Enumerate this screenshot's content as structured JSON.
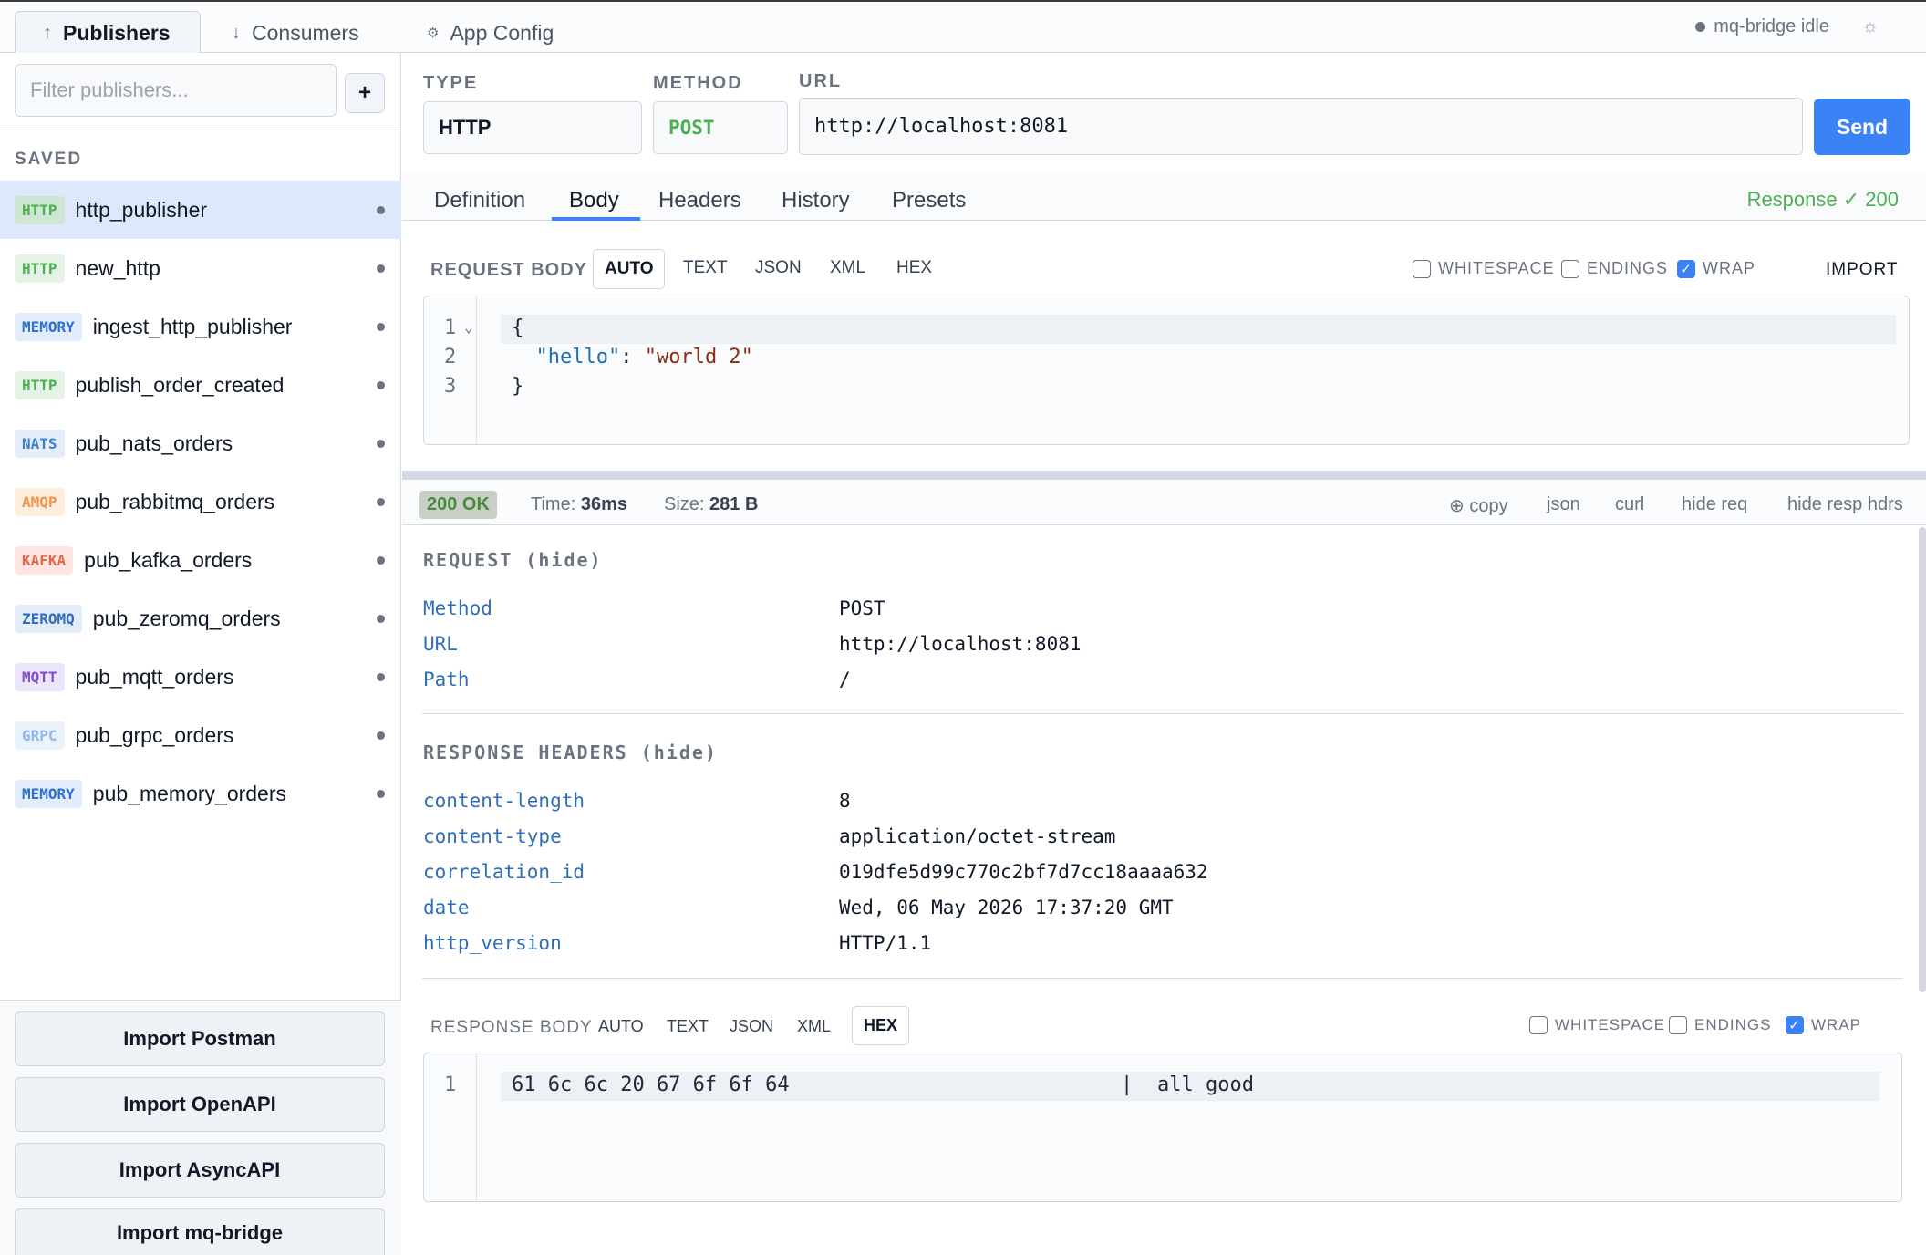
{
  "tabs": [
    {
      "label": "Publishers",
      "icon": "↑"
    },
    {
      "label": "Consumers",
      "icon": "↓"
    },
    {
      "label": "App Config",
      "icon": "⚙"
    }
  ],
  "status_text": "mq-bridge idle",
  "sidebar": {
    "filter_placeholder": "Filter publishers...",
    "add_label": "+",
    "saved_label": "SAVED",
    "items": [
      {
        "type": "HTTP",
        "name": "http_publisher"
      },
      {
        "type": "HTTP",
        "name": "new_http"
      },
      {
        "type": "MEMORY",
        "name": "ingest_http_publisher"
      },
      {
        "type": "HTTP",
        "name": "publish_order_created"
      },
      {
        "type": "NATS",
        "name": "pub_nats_orders"
      },
      {
        "type": "AMQP",
        "name": "pub_rabbitmq_orders"
      },
      {
        "type": "KAFKA",
        "name": "pub_kafka_orders"
      },
      {
        "type": "ZEROMQ",
        "name": "pub_zeromq_orders"
      },
      {
        "type": "MQTT",
        "name": "pub_mqtt_orders"
      },
      {
        "type": "GRPC",
        "name": "pub_grpc_orders"
      },
      {
        "type": "MEMORY",
        "name": "pub_memory_orders"
      }
    ],
    "imports": [
      "Import Postman",
      "Import OpenAPI",
      "Import AsyncAPI",
      "Import mq-bridge"
    ]
  },
  "request": {
    "type_label": "TYPE",
    "type_value": "HTTP",
    "method_label": "METHOD",
    "method_value": "POST",
    "url_label": "URL",
    "url_value": "http://localhost:8081",
    "send_label": "Send"
  },
  "subtabs": [
    "Definition",
    "Body",
    "Headers",
    "History",
    "Presets"
  ],
  "response_badge": "Response ✓ 200",
  "request_body": {
    "label": "REQUEST BODY",
    "formats": [
      "AUTO",
      "TEXT",
      "JSON",
      "XML",
      "HEX"
    ],
    "options": [
      "WHITESPACE",
      "ENDINGS",
      "WRAP"
    ],
    "import_label": "IMPORT",
    "line_numbers": [
      "1",
      "2",
      "3"
    ],
    "lines": [
      "{",
      "  \"hello\": \"world 2\"",
      "}"
    ],
    "key": "\"hello\"",
    "colon": ": ",
    "value": "\"world 2\""
  },
  "status_row": {
    "badge": "200 OK",
    "time_label": "Time:",
    "time_value": "36ms",
    "size_label": "Size:",
    "size_value": "281 B",
    "actions": [
      "copy",
      "json",
      "curl",
      "hide req",
      "hide resp hdrs"
    ]
  },
  "request_section": {
    "title": "REQUEST (hide)",
    "rows": [
      {
        "key": "Method",
        "value": "POST"
      },
      {
        "key": "URL",
        "value": "http://localhost:8081"
      },
      {
        "key": "Path",
        "value": "/"
      }
    ]
  },
  "response_headers": {
    "title": "RESPONSE HEADERS (hide)",
    "rows": [
      {
        "key": "content-length",
        "value": "8"
      },
      {
        "key": "content-type",
        "value": "application/octet-stream"
      },
      {
        "key": "correlation_id",
        "value": "019dfe5d99c770c2bf7d7cc18aaaa632"
      },
      {
        "key": "date",
        "value": "Wed, 06 May 2026 17:37:20 GMT"
      },
      {
        "key": "http_version",
        "value": "HTTP/1.1"
      }
    ]
  },
  "response_body": {
    "label": "RESPONSE BODY",
    "formats": [
      "AUTO",
      "TEXT",
      "JSON",
      "XML",
      "HEX"
    ],
    "options": [
      "WHITESPACE",
      "ENDINGS",
      "WRAP"
    ],
    "line_number": "1",
    "hex": "61 6c 6c 20 67 6f 6f 64",
    "separator": "|",
    "ascii": "all good"
  },
  "colors": {
    "accent": "#3b82f6",
    "success": "#4caf50",
    "http_badge_bg": "#e4f3e6",
    "http_badge_fg": "#4caf50",
    "memory_badge_bg": "#e2ecfa",
    "memory_badge_fg": "#2f6fd6",
    "nats_badge_bg": "#e4eefb",
    "nats_badge_fg": "#3f7fcf",
    "amqp_badge_bg": "#fdeede",
    "amqp_badge_fg": "#f0954a",
    "kafka_badge_bg": "#fde6e1",
    "kafka_badge_fg": "#e2674d",
    "zeromq_badge_bg": "#e4ecf7",
    "zeromq_badge_fg": "#2f6fbf",
    "mqtt_badge_bg": "#ece4f8",
    "mqtt_badge_fg": "#7e4fcf",
    "grpc_badge_bg": "#eaf2fb",
    "grpc_badge_fg": "#8fb8e8"
  }
}
